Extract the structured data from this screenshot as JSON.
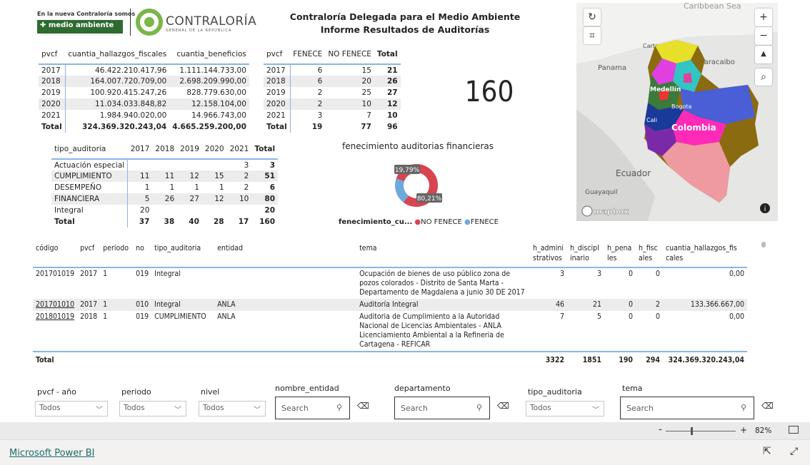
{
  "header": {
    "logo_tagline": "En la nueva Contraloría somos",
    "logo_badge": "medio ambiente",
    "logo_name": "CONTRALORÍA",
    "logo_sub": "GENERAL DE LA REPÚBLICA",
    "title_line1": "Contraloría Delegada para el Medio Ambiente",
    "title_line2": "Informe Resultados de Auditorías"
  },
  "table_cuantias": {
    "headers": [
      "pvcf",
      "cuantia_hallazgos_fiscales",
      "cuantia_beneficios"
    ],
    "rows": [
      [
        "2017",
        "46.422.210.417,96",
        "1.111.144.733,00"
      ],
      [
        "2018",
        "164.007.720.709,00",
        "2.698.209.990,00"
      ],
      [
        "2019",
        "100.920.415.247,26",
        "828.779.630,00"
      ],
      [
        "2020",
        "11.034.033.848,82",
        "12.158.104,00"
      ],
      [
        "2021",
        "1.984.940.020,00",
        "14.966.743,00"
      ]
    ],
    "total": [
      "Total",
      "324.369.320.243,04",
      "4.665.259.200,00"
    ]
  },
  "table_fenece": {
    "headers": [
      "pvcf",
      "FENECE",
      "NO FENECE",
      "Total"
    ],
    "rows": [
      [
        "2017",
        "6",
        "15",
        "21"
      ],
      [
        "2018",
        "6",
        "20",
        "26"
      ],
      [
        "2019",
        "2",
        "25",
        "27"
      ],
      [
        "2020",
        "2",
        "10",
        "12"
      ],
      [
        "2021",
        "3",
        "7",
        "10"
      ]
    ],
    "total": [
      "Total",
      "19",
      "77",
      "96"
    ]
  },
  "kpi": {
    "value": "160"
  },
  "table_tipo": {
    "headers": [
      "tipo_auditoria",
      "2017",
      "2018",
      "2019",
      "2020",
      "2021",
      "Total"
    ],
    "rows": [
      [
        "Actuación especial",
        "",
        "",
        "",
        "",
        "3",
        "3"
      ],
      [
        "CUMPLIMIENTO",
        "11",
        "11",
        "12",
        "15",
        "2",
        "51"
      ],
      [
        "DESEMPEÑO",
        "1",
        "1",
        "1",
        "1",
        "2",
        "6"
      ],
      [
        "FINANCIERA",
        "5",
        "26",
        "27",
        "12",
        "10",
        "80"
      ],
      [
        "Integral",
        "20",
        "",
        "",
        "",
        "",
        "20"
      ]
    ],
    "total": [
      "Total",
      "37",
      "38",
      "40",
      "28",
      "17",
      "160"
    ]
  },
  "chart_data": {
    "type": "pie",
    "title": "fenecimiento auditorias financieras",
    "legend_title": "fenecimiento_cu...",
    "legend_position": "bottom",
    "categories": [
      "NO FENECE",
      "FENECE"
    ],
    "values": [
      80.21,
      19.79
    ],
    "labels": [
      "80,21%",
      "19,79%"
    ],
    "colors": [
      "#d64550",
      "#6fa8dc"
    ]
  },
  "map": {
    "labels": [
      "Maracaibo",
      "Cartagena",
      "Panama",
      "Medellín",
      "Bogota",
      "Colombia",
      "Cali",
      "Ecuador",
      "Guayaquil",
      "Caribbean Sea"
    ],
    "attribution": "mapbox",
    "controls": [
      "+",
      "−"
    ]
  },
  "detail": {
    "headers": [
      "código",
      "pvcf",
      "periodo",
      "no",
      "tipo_auditoria",
      "entidad",
      "tema",
      "h_admini strativos",
      "h_discipl inario",
      "h_pena les",
      "h_fisc ales",
      "cuantia_hallazgos_fis cales"
    ],
    "sort_indicator": "▲",
    "rows": [
      [
        "201701019",
        "2017",
        "1",
        "019",
        "Integral",
        "",
        "Ocupación de bienes de uso público zona de pozos colorados - Distrito de Santa Marta - Departamento de Magdalena a junio 30 DE 2017",
        "3",
        "3",
        "0",
        "0",
        "0,00"
      ],
      [
        "201701010",
        "2017",
        "1",
        "010",
        "Integral",
        "ANLA",
        "Auditoría Integral",
        "46",
        "21",
        "0",
        "2",
        "133.366.667,00"
      ],
      [
        "201801019",
        "2018",
        "1",
        "019",
        "CUMPLIMIENTO",
        "ANLA",
        "Auditoria de Cumplimiento a la Autoridad Nacional de Licencias Ambientales - ANLA Licenciamiento Ambiental a la Refineria de Cartagena - REFICAR",
        "7",
        "5",
        "0",
        "0",
        "0,00"
      ]
    ],
    "total": [
      "Total",
      "3322",
      "1851",
      "190",
      "294",
      "324.369.320.243,04"
    ]
  },
  "slicers": {
    "pvcf": {
      "label": "pvcf - año",
      "value": "Todos"
    },
    "periodo": {
      "label": "periodo",
      "value": "Todos"
    },
    "nivel": {
      "label": "nivel",
      "value": "Todos"
    },
    "nombre_entidad": {
      "label": "nombre_entidad",
      "placeholder": "Search"
    },
    "departamento": {
      "label": "departamento",
      "placeholder": "Search"
    },
    "tipo_auditoria": {
      "label": "tipo_auditoria",
      "value": "Todos"
    },
    "tema": {
      "label": "tema",
      "placeholder": "Search"
    }
  },
  "zoom": {
    "level": "82%",
    "percent": 82
  },
  "footer": {
    "link": "Microsoft Power BI"
  }
}
